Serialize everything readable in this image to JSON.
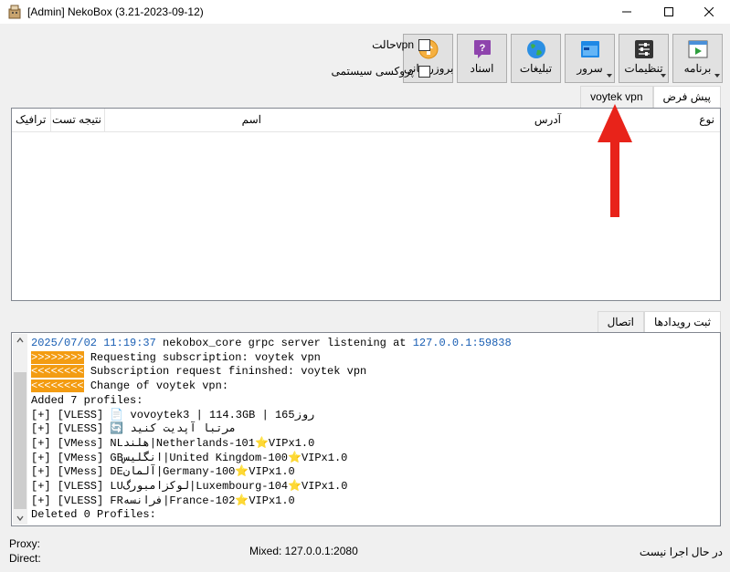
{
  "window": {
    "title": "[Admin] NekoBox (3.21-2023-09-12)",
    "controls": [
      "minimize-icon",
      "maximize-icon",
      "close-icon"
    ]
  },
  "toolbar": {
    "buttons": [
      {
        "label": "برنامه",
        "icon": "program-icon",
        "dropdown": true
      },
      {
        "label": "تنظیمات",
        "icon": "settings-icon",
        "dropdown": true
      },
      {
        "label": "سرور",
        "icon": "server-icon",
        "dropdown": true
      },
      {
        "label": "تبلیغات",
        "icon": "globe-icon",
        "dropdown": false
      },
      {
        "label": "اسناد",
        "icon": "docs-icon",
        "dropdown": false
      },
      {
        "label": "بروزرسانی",
        "icon": "update-icon",
        "dropdown": false
      }
    ]
  },
  "checkboxes": {
    "vpn_mode": {
      "label": "حالتvpn",
      "checked": false
    },
    "system_proxy": {
      "label": "پروکسی سیستمی",
      "checked": false
    }
  },
  "group_tabs": [
    {
      "label": "پیش فرض",
      "active": true
    },
    {
      "label": "voytek vpn",
      "active": false
    }
  ],
  "table": {
    "columns": [
      "نوع",
      "آدرس",
      "اسم",
      "نتیجه تست",
      "ترافیک"
    ]
  },
  "log_tabs": [
    {
      "label": "ثبت رویدادها",
      "active": true
    },
    {
      "label": "اتصال",
      "active": false
    }
  ],
  "log": {
    "first_timestamp": "2025/07/02 11:19:37",
    "first_message": "nekobox_core grpc server listening at",
    "first_address": "127.0.0.1:59838",
    "marker_in": ">>>>>>>>",
    "marker_out": "<<<<<<<<",
    "requesting": "Requesting subscription: voytek vpn",
    "finished": "Subscription request fininshed: voytek vpn",
    "change": "Change of voytek vpn:",
    "added": "Added 7 profiles:",
    "profiles": [
      "[+] [VLESS] 📄 vovoytek3 | 114.3GB | 165روز",
      "[+] [VLESS] 🔄 مرتبا آپدیت کنید",
      "[+] [VMess] NLهلند|Netherlands-101⭐VIPx1.0",
      "[+] [VMess] GBانگلیس|United Kingdom-100⭐VIPx1.0",
      "[+] [VMess] DEآلمان|Germany-100⭐VIPx1.0",
      "[+] [VLESS] LUلوکزامبورگ|Luxembourg-104⭐VIPx1.0",
      "[+] [VLESS] FRفرانسه|France-102⭐VIPx1.0"
    ],
    "deleted": "Deleted 0 Profiles:"
  },
  "status": {
    "proxy": "Proxy:",
    "direct": "Direct:",
    "mixed": "Mixed: 127.0.0.1:2080",
    "running": "در حال اجرا نیست"
  },
  "colors": {
    "timestamp": "#1a5fb4",
    "marker": "#f39c12",
    "annotation_arrow": "#e8231a"
  }
}
